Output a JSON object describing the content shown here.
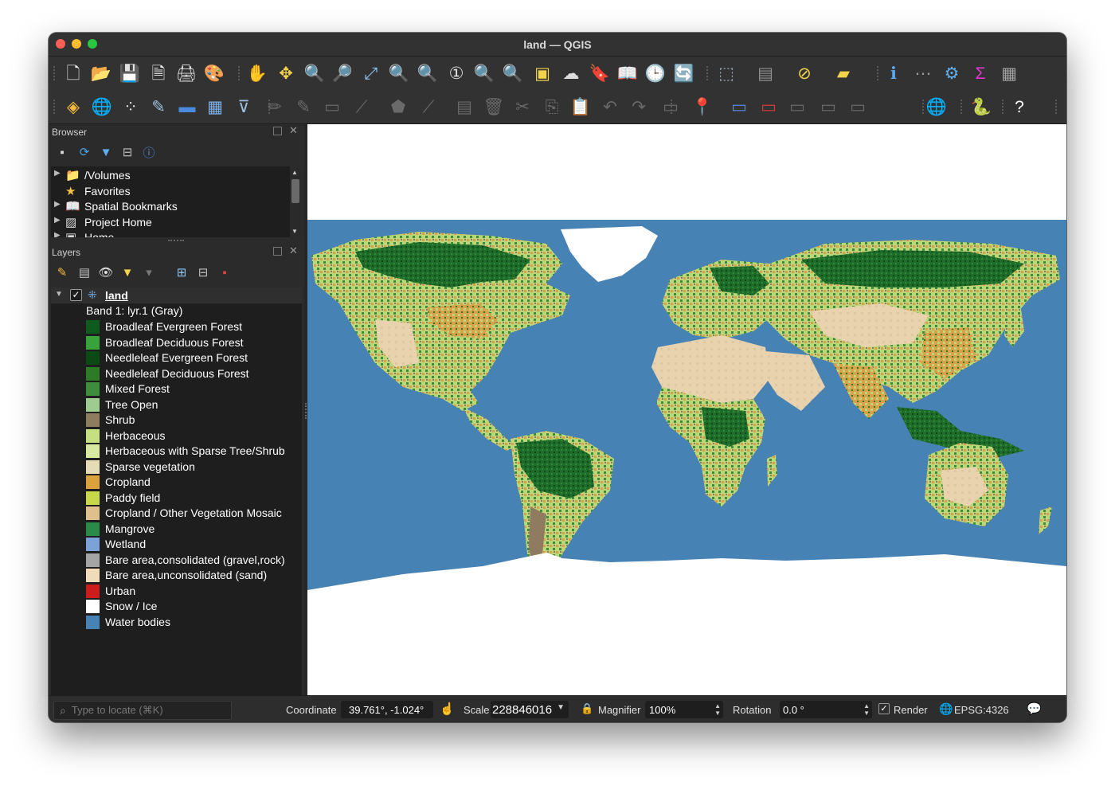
{
  "window": {
    "title": "land — QGIS"
  },
  "toolbar1": [
    {
      "name": "new-project-icon",
      "glyph": "🗋",
      "color": "#f0f0f0"
    },
    {
      "name": "open-project-icon",
      "glyph": "📂",
      "color": "#f5c242"
    },
    {
      "name": "save-project-icon",
      "glyph": "💾",
      "color": "#5a8fd8"
    },
    {
      "name": "save-as-icon",
      "glyph": "🗎",
      "color": "#f2f2f2"
    },
    {
      "name": "print-layout-icon",
      "glyph": "🖨",
      "color": "#e0e0e0"
    },
    {
      "name": "style-manager-icon",
      "glyph": "🎨",
      "color": "#e0a050"
    },
    {
      "name": "pan-map-icon",
      "glyph": "✋",
      "color": "#ffffff"
    },
    {
      "name": "pan-to-selection-icon",
      "glyph": "✥",
      "color": "#f2d34a"
    },
    {
      "name": "zoom-in-icon",
      "glyph": "🔍",
      "color": "#e8e8e8"
    },
    {
      "name": "zoom-out-icon",
      "glyph": "🔎",
      "color": "#e8e8e8"
    },
    {
      "name": "zoom-full-icon",
      "glyph": "⤢",
      "color": "#8ec5f0"
    },
    {
      "name": "zoom-to-selection-icon",
      "glyph": "🔍",
      "color": "#f2d34a"
    },
    {
      "name": "zoom-to-layer-icon",
      "glyph": "🔍",
      "color": "#d0d0d0"
    },
    {
      "name": "zoom-native-icon",
      "glyph": "①",
      "color": "#e0e0e0"
    },
    {
      "name": "zoom-last-icon",
      "glyph": "🔍",
      "color": "#777777"
    },
    {
      "name": "zoom-next-icon",
      "glyph": "🔍",
      "color": "#777777"
    },
    {
      "name": "new-map-view-icon",
      "glyph": "▣",
      "color": "#f2d34a"
    },
    {
      "name": "new-3d-map-view-icon",
      "glyph": "☁",
      "color": "#dddddd"
    },
    {
      "name": "new-spatial-bookmark-icon",
      "glyph": "🔖",
      "color": "#8ec5f0"
    },
    {
      "name": "show-bookmarks-icon",
      "glyph": "📖",
      "color": "#e0e0e0"
    },
    {
      "name": "temporal-controller-icon",
      "glyph": "🕒",
      "color": "#ffffff"
    },
    {
      "name": "refresh-icon",
      "glyph": "🔄",
      "color": "#4aa3e8"
    },
    {
      "name": "select-features-icon",
      "glyph": "⬚",
      "color": "#9aa6b8"
    },
    {
      "name": "select-by-value-icon",
      "glyph": "▤",
      "color": "#909090"
    },
    {
      "name": "deselect-all-icon",
      "glyph": "⊘",
      "color": "#f2d34a"
    },
    {
      "name": "select-location-icon",
      "glyph": "▰",
      "color": "#f2d34a"
    },
    {
      "name": "identify-features-icon",
      "glyph": "ℹ",
      "color": "#5aa8f0"
    },
    {
      "name": "measure-line-icon",
      "glyph": "⋯",
      "color": "#999999"
    },
    {
      "name": "toolbox-icon",
      "glyph": "⚙",
      "color": "#5fb0f2"
    },
    {
      "name": "statistics-icon",
      "glyph": "Σ",
      "color": "#e23ad0"
    },
    {
      "name": "attribute-table-icon",
      "glyph": "▦",
      "color": "#a0a0a0"
    }
  ],
  "toolbar2": [
    {
      "name": "data-source-manager-icon",
      "glyph": "◈",
      "color": "#f2b93b"
    },
    {
      "name": "add-vector-layer-icon",
      "glyph": "🌐",
      "color": "#7db0e8"
    },
    {
      "name": "new-shapefile-icon",
      "glyph": "⁘",
      "color": "#e0e0e0"
    },
    {
      "name": "new-geopackage-icon",
      "glyph": "✎",
      "color": "#9ec0e0"
    },
    {
      "name": "new-virtual-layer-icon",
      "glyph": "▬",
      "color": "#4a8be0"
    },
    {
      "name": "add-raster-icon",
      "glyph": "▦",
      "color": "#7db0e8"
    },
    {
      "name": "add-wms-icon",
      "glyph": "⊽",
      "color": "#9ec0e0"
    },
    {
      "name": "toggle-editing-icon",
      "glyph": "✏",
      "color": "#6a6a6a"
    },
    {
      "name": "edit-pencil-icon",
      "glyph": "✎",
      "color": "#6a6a6a"
    },
    {
      "name": "save-edits-icon",
      "glyph": "▭",
      "color": "#6a6a6a"
    },
    {
      "name": "digitize-icon",
      "glyph": "⟋",
      "color": "#6a6a6a"
    },
    {
      "name": "add-polygon-icon",
      "glyph": "⬟",
      "color": "#6a6a6a"
    },
    {
      "name": "vertex-tool-icon",
      "glyph": "⟋",
      "color": "#6a6a6a"
    },
    {
      "name": "modify-attributes-icon",
      "glyph": "▤",
      "color": "#6a6a6a"
    },
    {
      "name": "delete-selected-icon",
      "glyph": "🗑",
      "color": "#6a6a6a"
    },
    {
      "name": "cut-features-icon",
      "glyph": "✂",
      "color": "#6a6a6a"
    },
    {
      "name": "copy-features-icon",
      "glyph": "⎘",
      "color": "#6a6a6a"
    },
    {
      "name": "paste-features-icon",
      "glyph": "📋",
      "color": "#6a6a6a"
    },
    {
      "name": "undo-icon",
      "glyph": "↶",
      "color": "#6a6a6a"
    },
    {
      "name": "redo-icon",
      "glyph": "↷",
      "color": "#6a6a6a"
    },
    {
      "name": "label-toolbar-icon",
      "glyph": "▭",
      "color": "#6a6a6a"
    },
    {
      "name": "pin-labels-icon",
      "glyph": "📍",
      "color": "#6a6a6a"
    },
    {
      "name": "layer-labeling-icon",
      "glyph": "▭",
      "color": "#5a8fd8"
    },
    {
      "name": "highlight-labels-icon",
      "glyph": "▭",
      "color": "#d83a3a"
    },
    {
      "name": "move-label-icon",
      "glyph": "▭",
      "color": "#6a6a6a"
    },
    {
      "name": "rotate-label-icon",
      "glyph": "▭",
      "color": "#6a6a6a"
    },
    {
      "name": "change-label-icon",
      "glyph": "▭",
      "color": "#6a6a6a"
    },
    {
      "name": "plugin-globe-icon",
      "glyph": "🌐",
      "color": "#d8d8d8"
    },
    {
      "name": "python-console-icon",
      "glyph": "🐍",
      "color": "#f2c23a"
    },
    {
      "name": "help-icon",
      "glyph": "?",
      "color": "#ffffff"
    }
  ],
  "browser": {
    "title": "Browser",
    "items": [
      {
        "label": "/Volumes",
        "icon": "📁"
      },
      {
        "label": "Favorites",
        "icon": "★"
      },
      {
        "label": "Spatial Bookmarks",
        "icon": "📖"
      },
      {
        "label": "Project Home",
        "icon": "▨"
      },
      {
        "label": "Home",
        "icon": "▣"
      }
    ]
  },
  "layers": {
    "title": "Layers",
    "layer_name": "land",
    "band": "Band 1: lyr.1 (Gray)",
    "legend": [
      {
        "label": "Broadleaf Evergreen Forest",
        "color": "#0d5b1e"
      },
      {
        "label": "Broadleaf Deciduous Forest",
        "color": "#37a33a"
      },
      {
        "label": "Needleleaf Evergreen Forest",
        "color": "#0b4a15"
      },
      {
        "label": "Needleleaf Deciduous Forest",
        "color": "#2d7a27"
      },
      {
        "label": "Mixed Forest",
        "color": "#3e8d3c"
      },
      {
        "label": "Tree Open",
        "color": "#9ecb8f"
      },
      {
        "label": "Shrub",
        "color": "#8f7b5f"
      },
      {
        "label": "Herbaceous",
        "color": "#c6df80"
      },
      {
        "label": "Herbaceous with Sparse Tree/Shrub",
        "color": "#d8e8a0"
      },
      {
        "label": "Sparse vegetation",
        "color": "#e5dbb5"
      },
      {
        "label": "Cropland",
        "color": "#dba13d"
      },
      {
        "label": "Paddy field",
        "color": "#c7d949"
      },
      {
        "label": "Cropland / Other Vegetation Mosaic",
        "color": "#dfc08d"
      },
      {
        "label": "Mangrove",
        "color": "#2a8a4a"
      },
      {
        "label": "Wetland",
        "color": "#7ba3d8"
      },
      {
        "label": "Bare area,consolidated (gravel,rock)",
        "color": "#a5a5a5"
      },
      {
        "label": "Bare area,unconsolidated (sand)",
        "color": "#f0dcb8"
      },
      {
        "label": "Urban",
        "color": "#cc1c1c"
      },
      {
        "label": "Snow / Ice",
        "color": "#ffffff"
      },
      {
        "label": "Water bodies",
        "color": "#4682b4"
      }
    ]
  },
  "status": {
    "locate_placeholder": "Type to locate (⌘K)",
    "coordinate_label": "Coordinate",
    "coordinate_value": "39.761°, -1.024°",
    "scale_label": "Scale",
    "scale_value": "228846016",
    "magnifier_label": "Magnifier",
    "magnifier_value": "100%",
    "rotation_label": "Rotation",
    "rotation_value": "0.0 °",
    "render_label": "Render",
    "crs_label": "EPSG:4326"
  },
  "map": {
    "water_color": "#4682b4",
    "land_color": "#bfa77c",
    "forest_color": "#1e6b2a",
    "crop_color": "#d9a24a",
    "grass_color": "#bcd77a",
    "snow_color": "#ffffff"
  }
}
